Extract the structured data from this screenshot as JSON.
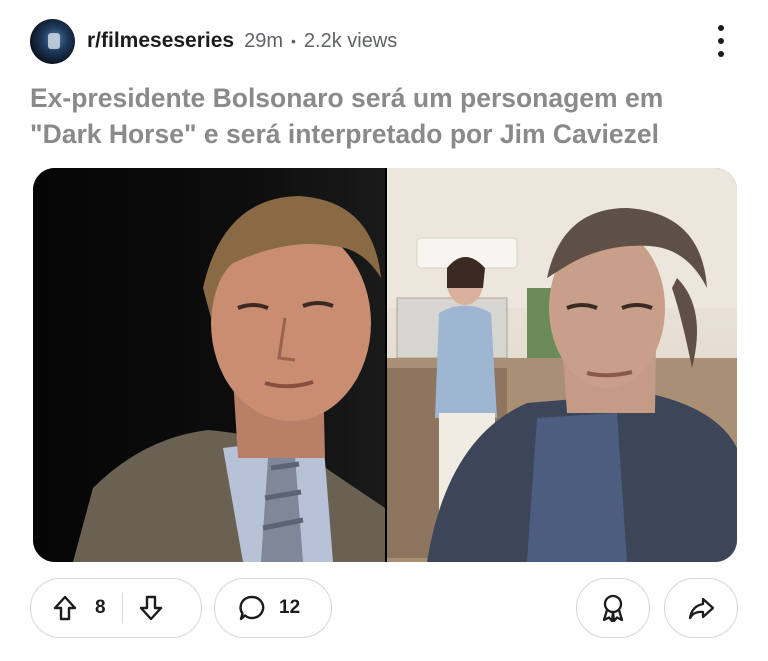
{
  "post": {
    "subreddit": "r/filmeseseries",
    "time_ago": "29m",
    "separator": "•",
    "views": "2.2k views",
    "title": "Ex-presidente Bolsonaro será um personagem em \"Dark Horse\" e será interpretado por Jim Caviezel"
  },
  "actions": {
    "upvote_count": "8",
    "comment_count": "12"
  },
  "icons": {
    "menu": "more-vertical-icon",
    "upvote": "arrow-up-icon",
    "downvote": "arrow-down-icon",
    "comments": "chat-bubble-icon",
    "award": "award-icon",
    "share": "share-icon"
  },
  "colors": {
    "title_text": "#8a8a8a",
    "meta_text": "#5f6368",
    "pill_border": "#d6d6d6"
  }
}
